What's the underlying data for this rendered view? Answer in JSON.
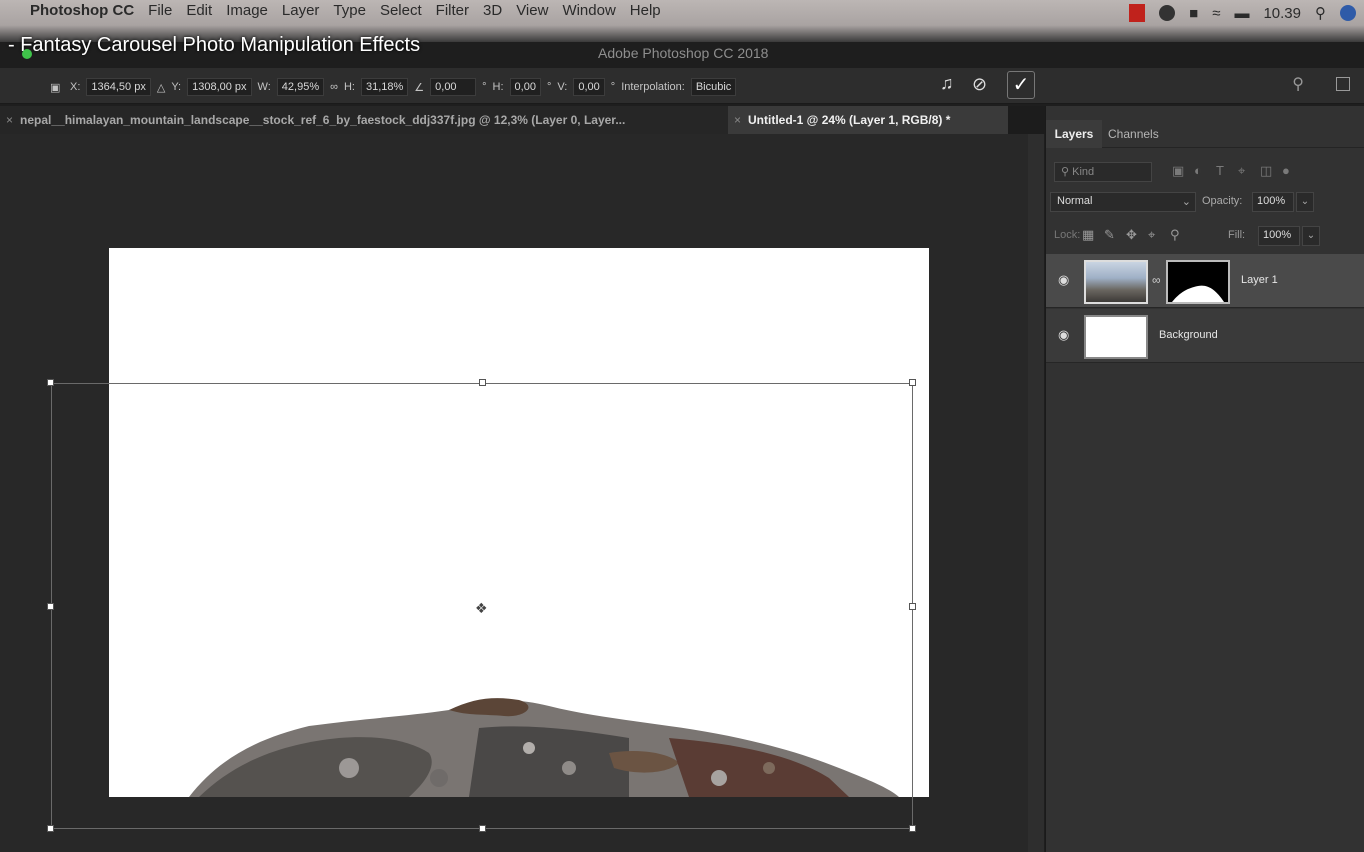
{
  "menubar": {
    "items": [
      "Photoshop CC",
      "File",
      "Edit",
      "Image",
      "Layer",
      "Type",
      "Select",
      "Filter",
      "3D",
      "View",
      "Window",
      "Help"
    ],
    "clock": "10.39"
  },
  "overlay_title": "- Fantasy Carousel Photo Manipulation Effects",
  "window_title": "Adobe Photoshop CC 2018",
  "options": {
    "x_label": "X:",
    "x_value": "1364,50 px",
    "y_label": "Y:",
    "y_value": "1308,00 px",
    "w_label": "W:",
    "w_value": "42,95%",
    "h_label": "H:",
    "h_value": "31,18%",
    "angle_value": "0,00",
    "hskew_label": "H:",
    "hskew_value": "0,00",
    "vskew_label": "V:",
    "vskew_value": "0,00",
    "degree": "°",
    "interp_label": "Interpolation:",
    "interp_value": "Bicubic"
  },
  "tabs": [
    {
      "label": "nepal__himalayan_mountain_landscape__stock_ref_6_by_faestock_ddj337f.jpg @ 12,3% (Layer 0, Layer...",
      "active": false
    },
    {
      "label": "Untitled-1 @ 24% (Layer 1, RGB/8) *",
      "active": true
    }
  ],
  "panel": {
    "tabs": [
      "Layers",
      "Channels"
    ],
    "kind_placeholder": "Kind",
    "blend_mode": "Normal",
    "opacity_label": "Opacity:",
    "opacity_value": "100%",
    "lock_label": "Lock:",
    "fill_label": "Fill:",
    "fill_value": "100%",
    "layers": [
      {
        "name": "Layer 1",
        "selected": true
      },
      {
        "name": "Background",
        "selected": false
      }
    ]
  },
  "colors": {
    "workspace": "#282828",
    "panel": "#323232",
    "selected_layer": "#4a4a4a",
    "accent_green": "#3fc44a"
  }
}
